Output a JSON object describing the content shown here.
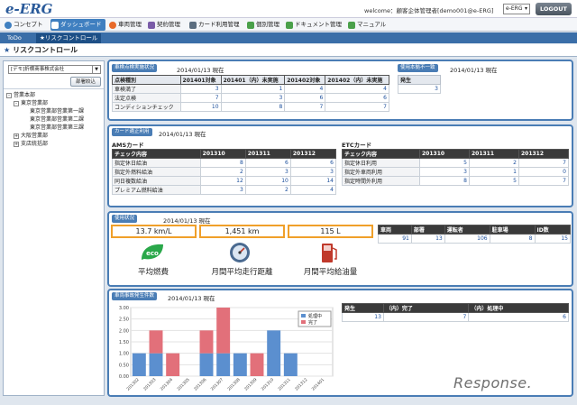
{
  "header": {
    "logo": "e-ERG",
    "welcome": "welcome：顧客企体管理者[demo001@e-ERG]",
    "selector_value": "e-ERG",
    "logout": "LOGOUT"
  },
  "nav": [
    {
      "label": "コンセプト",
      "icon": "globe-icon",
      "color": "#3f7fc0"
    },
    {
      "label": "ダッシュボード",
      "icon": "dashboard-icon",
      "color": "#ffffff",
      "active": true
    },
    {
      "label": "車両管理",
      "icon": "vehicle-icon",
      "color": "#e86a2a"
    },
    {
      "label": "契約管理",
      "icon": "contract-icon",
      "color": "#7a5ca8"
    },
    {
      "label": "カード利用管理",
      "icon": "card-icon",
      "color": "#5c6e80"
    },
    {
      "label": "個別管理",
      "icon": "person-icon",
      "color": "#4aa04a"
    },
    {
      "label": "ドキュメント管理",
      "icon": "document-icon",
      "color": "#4aa04a"
    },
    {
      "label": "マニュアル",
      "icon": "manual-icon",
      "color": "#4aa04a"
    }
  ],
  "subnav": [
    {
      "label": "ToDo"
    },
    {
      "label": "★リスクコントロール",
      "active": true
    }
  ],
  "page_title": "リスクコントロール",
  "sidebar": {
    "company": "[デモ]折横商事株式会社",
    "org_button": "部署絞込",
    "tree": [
      {
        "label": "営業本部",
        "level": 0,
        "toggle": "-"
      },
      {
        "label": "東京営業部",
        "level": 1,
        "toggle": "-"
      },
      {
        "label": "東京営業部営業第一課",
        "level": 2
      },
      {
        "label": "東京営業部営業第二課",
        "level": 2
      },
      {
        "label": "東京営業部営業第三課",
        "level": 2
      },
      {
        "label": "大阪営業部",
        "level": 1,
        "toggle": "+"
      },
      {
        "label": "支店統括部",
        "level": 1,
        "toggle": "+"
      }
    ]
  },
  "inspection": {
    "title": "車検点検実施状況",
    "date": "2014/01/13 現在",
    "headers": [
      "点検種別",
      "201401対象",
      "201401（内）未実施",
      "201402対象",
      "201402（内）未実施"
    ],
    "rows": [
      [
        "車検満了",
        "3",
        "1",
        "4",
        "4"
      ],
      [
        "法定点検",
        "7",
        "3",
        "6",
        "6"
      ],
      [
        "コンディションチェック",
        "10",
        "8",
        "7",
        "7"
      ]
    ]
  },
  "mismatch": {
    "title": "使用本拠不一致",
    "date": "2014/01/13 現在",
    "header": "発生",
    "value": "3"
  },
  "card": {
    "title": "カード適正利用",
    "date": "2014/01/13 現在",
    "ams": {
      "label": "AMSカード",
      "headers": [
        "チェック内容",
        "201310",
        "201311",
        "201312"
      ],
      "rows": [
        [
          "指定休日給油",
          "8",
          "6",
          "6"
        ],
        [
          "指定外燃料給油",
          "2",
          "3",
          "3"
        ],
        [
          "同日複数給油",
          "12",
          "10",
          "14"
        ],
        [
          "プレミアム燃料給油",
          "3",
          "2",
          "4"
        ]
      ]
    },
    "etc": {
      "label": "ETCカード",
      "headers": [
        "チェック内容",
        "201310",
        "201311",
        "201312"
      ],
      "rows": [
        [
          "指定休日利用",
          "5",
          "2",
          "7"
        ],
        [
          "指定外車両利用",
          "3",
          "1",
          "0"
        ],
        [
          "指定時間外利用",
          "8",
          "5",
          "7"
        ]
      ]
    }
  },
  "usage": {
    "title": "使用状況",
    "date": "2014/01/13 現在",
    "kpis": [
      {
        "value": "13.7 km/L",
        "label": "平均燃費",
        "icon": "eco-icon"
      },
      {
        "value": "1,451 km",
        "label": "月間平均走行距離",
        "icon": "speedometer-icon"
      },
      {
        "value": "115 L",
        "label": "月間平均給油量",
        "icon": "fuel-pump-icon"
      }
    ],
    "table_headers": [
      "車両",
      "部署",
      "運転者",
      "駐車場",
      "ID数"
    ],
    "table_values": [
      "91",
      "13",
      "106",
      "8",
      "15"
    ]
  },
  "accident": {
    "title": "車両事故発生件数",
    "date": "2014/01/13 現在",
    "table_headers": [
      "発生",
      "（内）完了",
      "（内）処理中"
    ],
    "table_values": [
      "13",
      "7",
      "6"
    ]
  },
  "chart_data": {
    "type": "bar",
    "stacked": true,
    "categories": [
      "201302",
      "201303",
      "201304",
      "201305",
      "201306",
      "201307",
      "201308",
      "201309",
      "201310",
      "201311",
      "201312",
      "201401"
    ],
    "series": [
      {
        "name": "処理中",
        "color": "#5b8fcf",
        "values": [
          1,
          1,
          0,
          0,
          1,
          1,
          1,
          0,
          2,
          1,
          0,
          0
        ]
      },
      {
        "name": "完了",
        "color": "#e2707a",
        "values": [
          0,
          1,
          1,
          0,
          1,
          2,
          0,
          1,
          0,
          0,
          0,
          0
        ]
      }
    ],
    "ylim": [
      0,
      3
    ],
    "yticks": [
      "3.00",
      "2.50",
      "2.00",
      "1.50",
      "1.00",
      "0.50",
      "0.00"
    ],
    "legend": "top-right",
    "grid": true
  },
  "watermark": "Response."
}
